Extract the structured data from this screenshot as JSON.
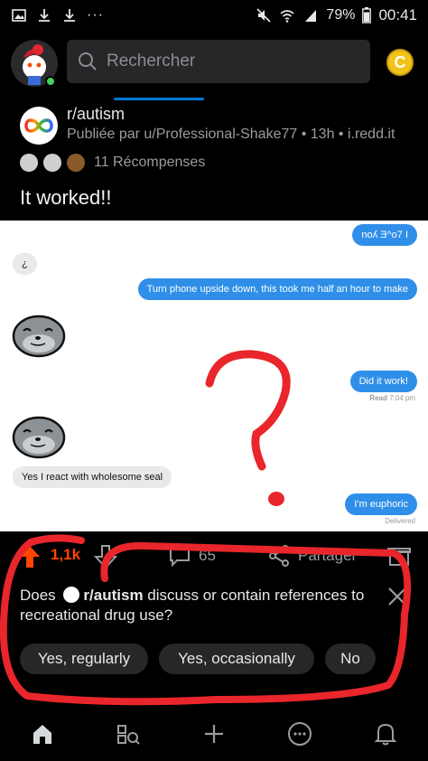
{
  "status_bar": {
    "battery": "79%",
    "time": "00:41",
    "left_icons": [
      "image-icon",
      "download-icon",
      "download-icon",
      "more-icon"
    ]
  },
  "header": {
    "search_placeholder": "Rechercher",
    "coin_label": "C"
  },
  "post": {
    "subreddit": "r/autism",
    "posted_by": "Publiée par u/Professional-Shake77 • 13h • i.redd.it",
    "awards_label": "11 Récompenses",
    "title": "It worked!!"
  },
  "chat": {
    "msg1": "noʎ Ǝ^o7 I",
    "msg2": "¿",
    "msg3": "Turn phone upside down, this took me half an hour to make",
    "msg4": "Did it work!",
    "msg4_status_bold": "Read",
    "msg4_status_time": "7:04 pm",
    "msg5": "Yes I react with wholesome seal",
    "msg6": "I'm euphoric",
    "msg6_status": "Delivered"
  },
  "actions": {
    "score": "1,1k",
    "comments": "65",
    "share": "Partager"
  },
  "poll": {
    "question_pre": "Does",
    "question_sub": "r/autism",
    "question_post": "discuss or contain references to recreational drug use?",
    "options": [
      "Yes, regularly",
      "Yes, occasionally",
      "No"
    ]
  },
  "colors": {
    "accent": "#0079d3",
    "upvote": "#ff4500",
    "annotation": "#e8262b",
    "imessage_blue": "#2f8fe8"
  }
}
